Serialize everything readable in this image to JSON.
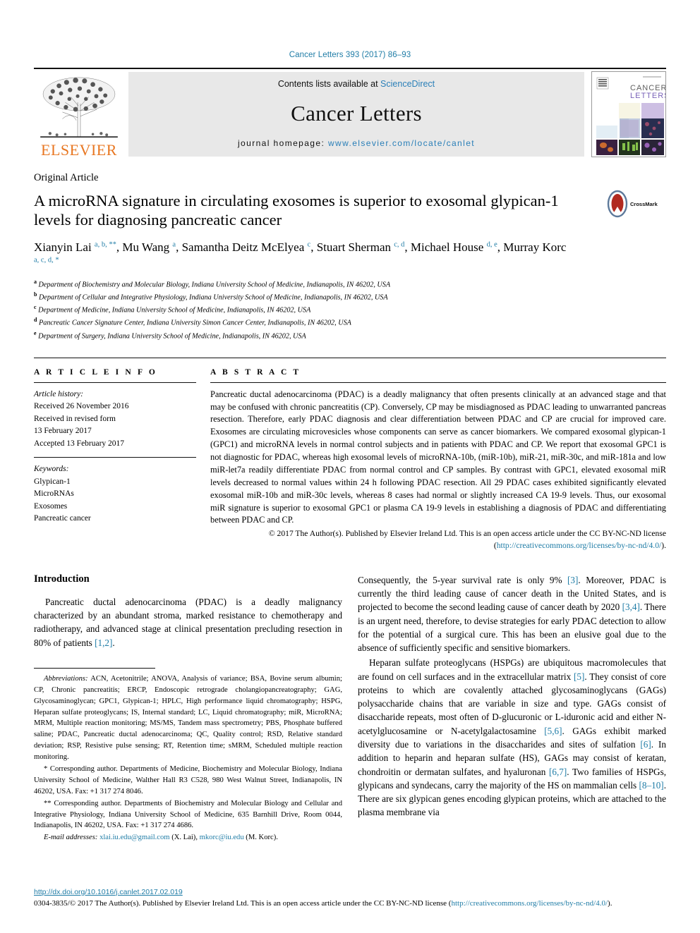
{
  "running_head": "Cancer Letters 393 (2017) 86–93",
  "masthead": {
    "publisher_name": "ELSEVIER",
    "contents_prefix": "Contents lists available at ",
    "contents_link": "ScienceDirect",
    "journal_title": "Cancer Letters",
    "homepage_prefix": "journal homepage: ",
    "homepage_url": "www.elsevier.com/locate/canlet",
    "cover_title_line1": "CANCER",
    "cover_title_line2": "LETTERS"
  },
  "article": {
    "type": "Original Article",
    "title": "A microRNA signature in circulating exosomes is superior to exosomal glypican-1 levels for diagnosing pancreatic cancer",
    "crossmark_label": "CrossMark",
    "authors_html": "Xianyin Lai <sup>a, b, **</sup>, Mu Wang <sup>a</sup>, Samantha Deitz McElyea <sup>c</sup>, Stuart Sherman <sup>c, d</sup>, Michael House <sup>d, e</sup>, Murray Korc <sup>a, c, d, *</sup>",
    "affiliations": [
      {
        "marker": "a",
        "text": "Department of Biochemistry and Molecular Biology, Indiana University School of Medicine, Indianapolis, IN 46202, USA"
      },
      {
        "marker": "b",
        "text": "Department of Cellular and Integrative Physiology, Indiana University School of Medicine, Indianapolis, IN 46202, USA"
      },
      {
        "marker": "c",
        "text": "Department of Medicine, Indiana University School of Medicine, Indianapolis, IN 46202, USA"
      },
      {
        "marker": "d",
        "text": "Pancreatic Cancer Signature Center, Indiana University Simon Cancer Center, Indianapolis, IN 46202, USA"
      },
      {
        "marker": "e",
        "text": "Department of Surgery, Indiana University School of Medicine, Indianapolis, IN 46202, USA"
      }
    ]
  },
  "article_info": {
    "heading": "A R T I C L E   I N F O",
    "history_label": "Article history:",
    "history": [
      "Received 26 November 2016",
      "Received in revised form",
      "13 February 2017",
      "Accepted 13 February 2017"
    ],
    "keywords_label": "Keywords:",
    "keywords": [
      "Glypican-1",
      "MicroRNAs",
      "Exosomes",
      "Pancreatic cancer"
    ]
  },
  "abstract": {
    "heading": "A B S T R A C T",
    "text": "Pancreatic ductal adenocarcinoma (PDAC) is a deadly malignancy that often presents clinically at an advanced stage and that may be confused with chronic pancreatitis (CP). Conversely, CP may be misdiagnosed as PDAC leading to unwarranted pancreas resection. Therefore, early PDAC diagnosis and clear differentiation between PDAC and CP are crucial for improved care. Exosomes are circulating microvesicles whose components can serve as cancer biomarkers. We compared exosomal glypican-1 (GPC1) and microRNA levels in normal control subjects and in patients with PDAC and CP. We report that exosomal GPC1 is not diagnostic for PDAC, whereas high exosomal levels of microRNA-10b, (miR-10b), miR-21, miR-30c, and miR-181a and low miR-let7a readily differentiate PDAC from normal control and CP samples. By contrast with GPC1, elevated exosomal miR levels decreased to normal values within 24 h following PDAC resection. All 29 PDAC cases exhibited significantly elevated exosomal miR-10b and miR-30c levels, whereas 8 cases had normal or slightly increased CA 19-9 levels. Thus, our exosomal miR signature is superior to exosomal GPC1 or plasma CA 19-9 levels in establishing a diagnosis of PDAC and differentiating between PDAC and CP.",
    "copyright_text": "© 2017 The Author(s). Published by Elsevier Ireland Ltd. This is an open access article under the CC BY-NC-ND license (",
    "copyright_link": "http://creativecommons.org/licenses/by-nc-nd/4.0/",
    "copyright_suffix": ")."
  },
  "introduction": {
    "heading": "Introduction",
    "p1_a": "Pancreatic ductal adenocarcinoma (PDAC) is a deadly malignancy characterized by an abundant stroma, marked resistance to chemotherapy and radiotherapy, and advanced stage at clinical presentation precluding resection in 80% of patients ",
    "p1_ref": "[1,2]",
    "p1_b": ".",
    "p2_a": "Consequently, the 5-year survival rate is only 9% ",
    "p2_ref1": "[3]",
    "p2_b": ". Moreover, PDAC is currently the third leading cause of cancer death in the United States, and is projected to become the second leading cause of cancer death by 2020 ",
    "p2_ref2": "[3,4]",
    "p2_c": ". There is an urgent need, therefore, to devise strategies for early PDAC detection to allow for the potential of a surgical cure. This has been an elusive goal due to the absence of sufficiently specific and sensitive biomarkers.",
    "p3_a": "Heparan sulfate proteoglycans (HSPGs) are ubiquitous macromolecules that are found on cell surfaces and in the extracellular matrix ",
    "p3_ref1": "[5]",
    "p3_b": ". They consist of core proteins to which are covalently attached glycosaminoglycans (GAGs) polysaccharide chains that are variable in size and type. GAGs consist of disaccharide repeats, most often of D-glucuronic or L-iduronic acid and either N-acetylglucosamine or N-acetylgalactosamine ",
    "p3_ref2": "[5,6]",
    "p3_c": ". GAGs exhibit marked diversity due to variations in the disaccharides and sites of sulfation ",
    "p3_ref3": "[6]",
    "p3_d": ". In addition to heparin and heparan sulfate (HS), GAGs may consist of keratan, chondroitin or dermatan sulfates, and hyaluronan ",
    "p3_ref4": "[6,7]",
    "p3_e": ". Two families of HSPGs, glypicans and syndecans, carry the majority of the HS on mammalian cells ",
    "p3_ref5": "[8–10]",
    "p3_f": ". There are six glypican genes encoding glypican proteins, which are attached to the plasma membrane via"
  },
  "footnotes": {
    "abbreviations_label": "Abbreviations:",
    "abbreviations_text": " ACN, Acetonitrile; ANOVA, Analysis of variance; BSA, Bovine serum albumin; CP, Chronic pancreatitis; ERCP, Endoscopic retrograde cholangiopancreatography; GAG, Glycosaminoglycan; GPC1, Glypican-1; HPLC, High performance liquid chromatography; HSPG, Heparan sulfate proteoglycans; IS, Internal standard; LC, Liquid chromatography; miR, MicroRNA; MRM, Multiple reaction monitoring; MS/MS, Tandem mass spectrometry; PBS, Phosphate buffered saline; PDAC, Pancreatic ductal adenocarcinoma; QC, Quality control; RSD, Relative standard deviation; RSP, Resistive pulse sensing; RT, Retention time; sMRM, Scheduled multiple reaction monitoring.",
    "corr1": "* Corresponding author. Departments of Medicine, Biochemistry and Molecular Biology, Indiana University School of Medicine, Walther Hall R3 C528, 980 West Walnut Street, Indianapolis, IN 46202, USA. Fax: +1 317 274 8046.",
    "corr2": "** Corresponding author. Departments of Biochemistry and Molecular Biology and Cellular and Integrative Physiology, Indiana University School of Medicine, 635 Barnhill Drive, Room 0044, Indianapolis, IN 46202, USA. Fax: +1 317 274 4686.",
    "email_label": "E-mail addresses:",
    "email1": "xlai.iu.edu@gmail.com",
    "email1_owner": " (X. Lai), ",
    "email2": "mkorc@iu.edu",
    "email2_owner": " (M. Korc)."
  },
  "page_footer": {
    "doi": "http://dx.doi.org/10.1016/j.canlet.2017.02.019",
    "license_prefix": "0304-3835/© 2017 The Author(s). Published by Elsevier Ireland Ltd. This is an open access article under the CC BY-NC-ND license (",
    "license_link": "http://creativecommons.org/licenses/by-nc-nd/4.0/",
    "license_suffix": ")."
  },
  "colors": {
    "link": "#1f7ca6",
    "elsevier_orange": "#E87722",
    "band_grey": "#e8e8e8"
  }
}
